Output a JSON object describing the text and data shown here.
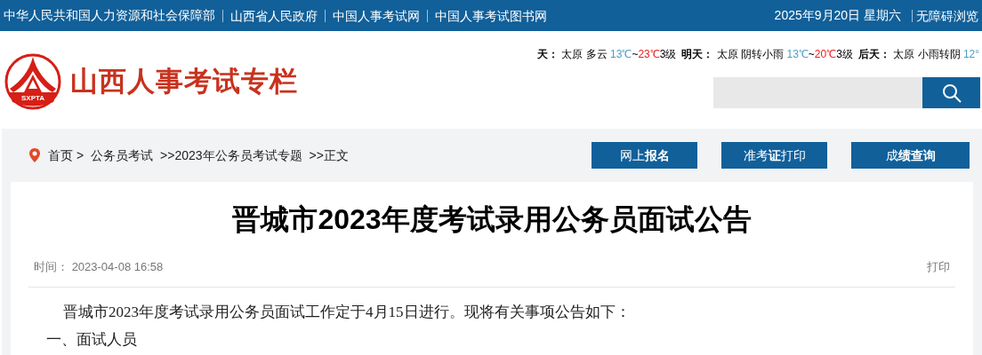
{
  "top_bar": {
    "links": [
      "中华人民共和国人力资源和社会保障部",
      "山西省人民政府",
      "中国人事考试网",
      "中国人事考试图书网"
    ],
    "date": "2025年9月20日 星期六",
    "accessibility": "无障碍浏览"
  },
  "header": {
    "logo_text": "SXPTA",
    "site_title": "山西人事考试专栏",
    "weather": [
      {
        "day": "天：",
        "city": "太原",
        "condition": "多云",
        "low": "13℃",
        "range_sep": "~",
        "high": "23℃",
        "wind": "3级"
      },
      {
        "day": "明天：",
        "city": "太原",
        "condition": "阴转小雨",
        "low": "13℃",
        "range_sep": "~",
        "high": "20℃",
        "wind": "3级"
      },
      {
        "day": "后天：",
        "city": "太原",
        "condition": "小雨转阴",
        "low": "12°"
      }
    ]
  },
  "breadcrumb": [
    "首页 >",
    "公务员考试",
    ">>2023年公务员考试专题",
    ">>正文"
  ],
  "action_buttons": [
    "网上**报名**",
    "准考**证**打印",
    "成**绩查询**"
  ],
  "article": {
    "title": "晋城市2023年度考试录用公务员面试公告",
    "time_label": "时间：",
    "time": "2023-04-08 16:58",
    "print": "打印",
    "paragraphs": [
      "晋城市2023年度考试录用公务员面试工作定于4月15日进行。现将有关事项公告如下：",
      "一、面试人员"
    ]
  }
}
